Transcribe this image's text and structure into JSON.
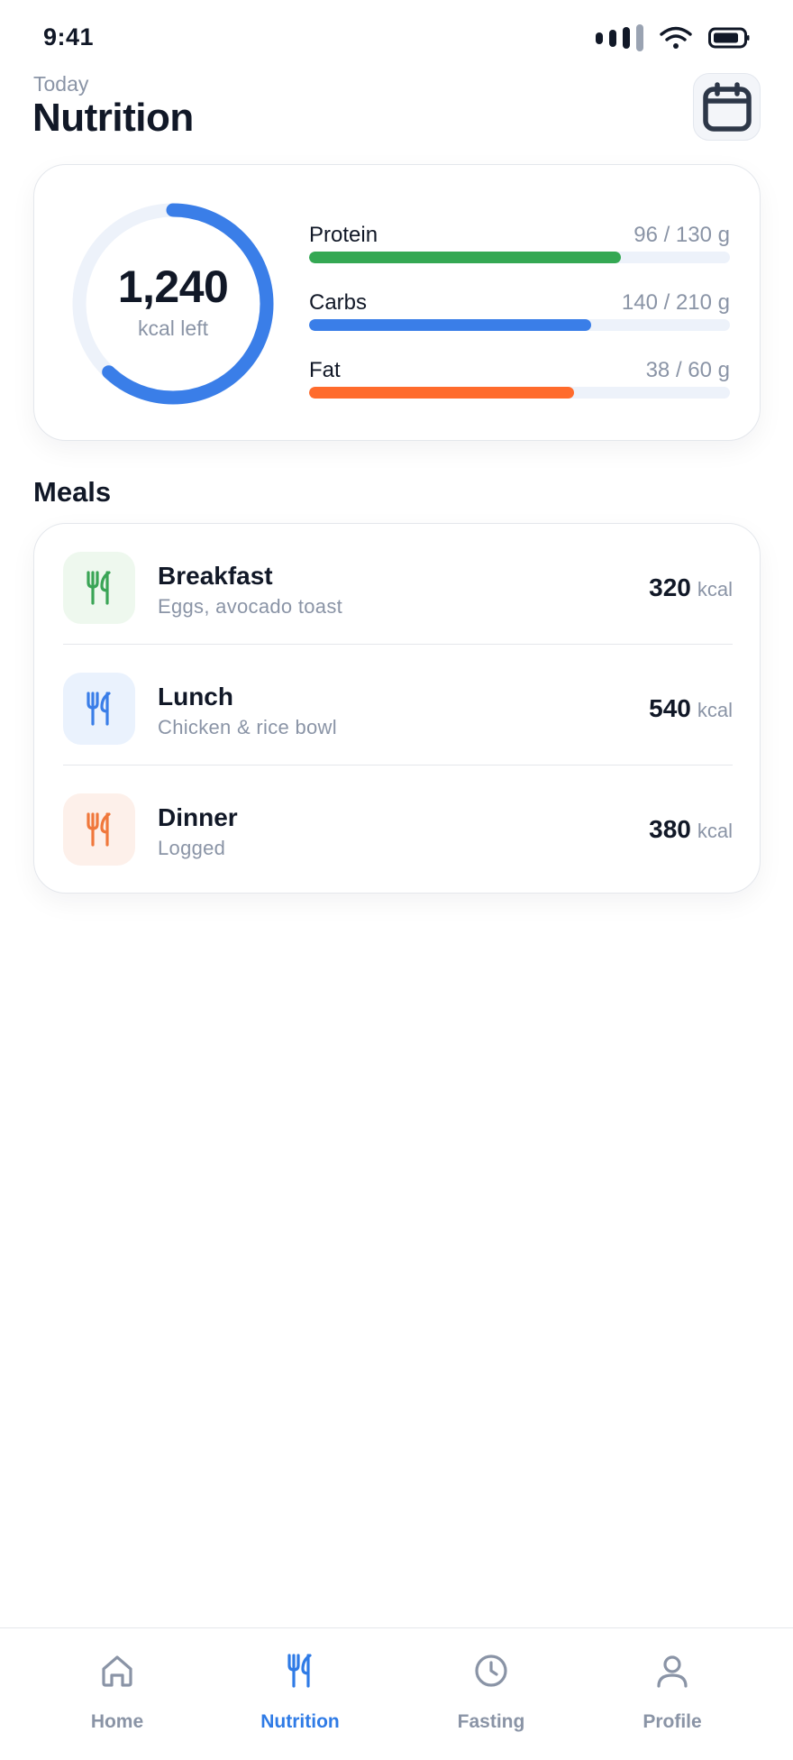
{
  "status_bar": {
    "time": "9:41"
  },
  "header": {
    "subtitle": "Today",
    "title": "Nutrition"
  },
  "summary": {
    "calories_left": "1,240",
    "calories_label": "kcal left",
    "ring_progress": 0.62,
    "macros": [
      {
        "name": "Protein",
        "value": "96 / 130 g",
        "progress": 0.74,
        "color": "#34a853"
      },
      {
        "name": "Carbs",
        "value": "140 / 210 g",
        "progress": 0.67,
        "color": "#3a7ee8"
      },
      {
        "name": "Fat",
        "value": "38 / 60 g",
        "progress": 0.63,
        "color": "#ff6b2c"
      }
    ]
  },
  "meals": {
    "title": "Meals",
    "items": [
      {
        "name": "Breakfast",
        "description": "Eggs, avocado toast",
        "kcal": "320",
        "unit": "kcal",
        "icon": "fork-knife-icon",
        "color": "#3aa556",
        "bg": "#eef8ee"
      },
      {
        "name": "Lunch",
        "description": "Chicken & rice bowl",
        "kcal": "540",
        "unit": "kcal",
        "icon": "fork-knife-icon",
        "color": "#3a7ee8",
        "bg": "#eaf2fd"
      },
      {
        "name": "Dinner",
        "description": "Logged",
        "kcal": "380",
        "unit": "kcal",
        "icon": "fork-knife-icon",
        "color": "#f0783c",
        "bg": "#fdf0ea"
      }
    ]
  },
  "tab_bar": {
    "tabs": [
      {
        "label": "Home",
        "icon": "home-icon",
        "active": false
      },
      {
        "label": "Nutrition",
        "icon": "fork-knife-icon",
        "active": true
      },
      {
        "label": "Fasting",
        "icon": "clock-icon",
        "active": false
      },
      {
        "label": "Profile",
        "icon": "person-icon",
        "active": false
      }
    ]
  },
  "colors": {
    "accent": "#2f7be6",
    "ring": "#3a7ee8",
    "ring_track": "#edf2fa"
  }
}
